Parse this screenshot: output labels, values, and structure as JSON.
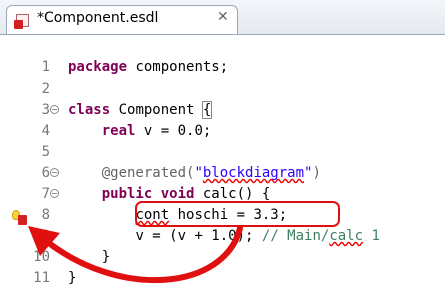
{
  "tab": {
    "title": "*Component.esdl",
    "close_glyph": "✕",
    "icon": "esdl-file-error-icon"
  },
  "editor": {
    "lines": [
      {
        "num": "1",
        "fold": false
      },
      {
        "num": "2",
        "fold": false
      },
      {
        "num": "3",
        "fold": true
      },
      {
        "num": "4",
        "fold": false
      },
      {
        "num": "5",
        "fold": false
      },
      {
        "num": "6",
        "fold": true
      },
      {
        "num": "7",
        "fold": true
      },
      {
        "num": "8",
        "fold": false
      },
      {
        "num": "9",
        "fold": false
      },
      {
        "num": "10",
        "fold": false
      },
      {
        "num": "11",
        "fold": false
      }
    ],
    "code": {
      "l1_kw": "package",
      "l1_rest": " components;",
      "l3_kw": "class",
      "l3_rest": " Component ",
      "l3_brace": "{",
      "l4_indent": "    ",
      "l4_kw": "real",
      "l4_rest": " v = ",
      "l4_num": "0.0",
      "l4_end": ";",
      "l6_indent": "    ",
      "l6_ann": "@generated(",
      "l6_str_pre": "\"",
      "l6_str": "blockdiagram",
      "l6_str_post": "\"",
      "l6_end": ")",
      "l7_indent": "    ",
      "l7_kw1": "public",
      "l7_sp": " ",
      "l7_kw2": "void",
      "l7_rest": " calc() {",
      "l8_indent": "        ",
      "l8_err": "cont",
      "l8_rest": " hoschi = ",
      "l8_num": "3.3",
      "l8_end": ";",
      "l9_indent": "        ",
      "l9_code": "v = (v + ",
      "l9_num": "1.0",
      "l9_end": "); ",
      "l9_cmt_pre": "// Main/",
      "l9_cmt_sq": "calc",
      "l9_cmt_post": " 1",
      "l10_indent": "    ",
      "l10_code": "}",
      "l11_code": "}"
    }
  },
  "annotations": {
    "highlight_color": "#e01010",
    "arrow_color": "#e01010"
  }
}
